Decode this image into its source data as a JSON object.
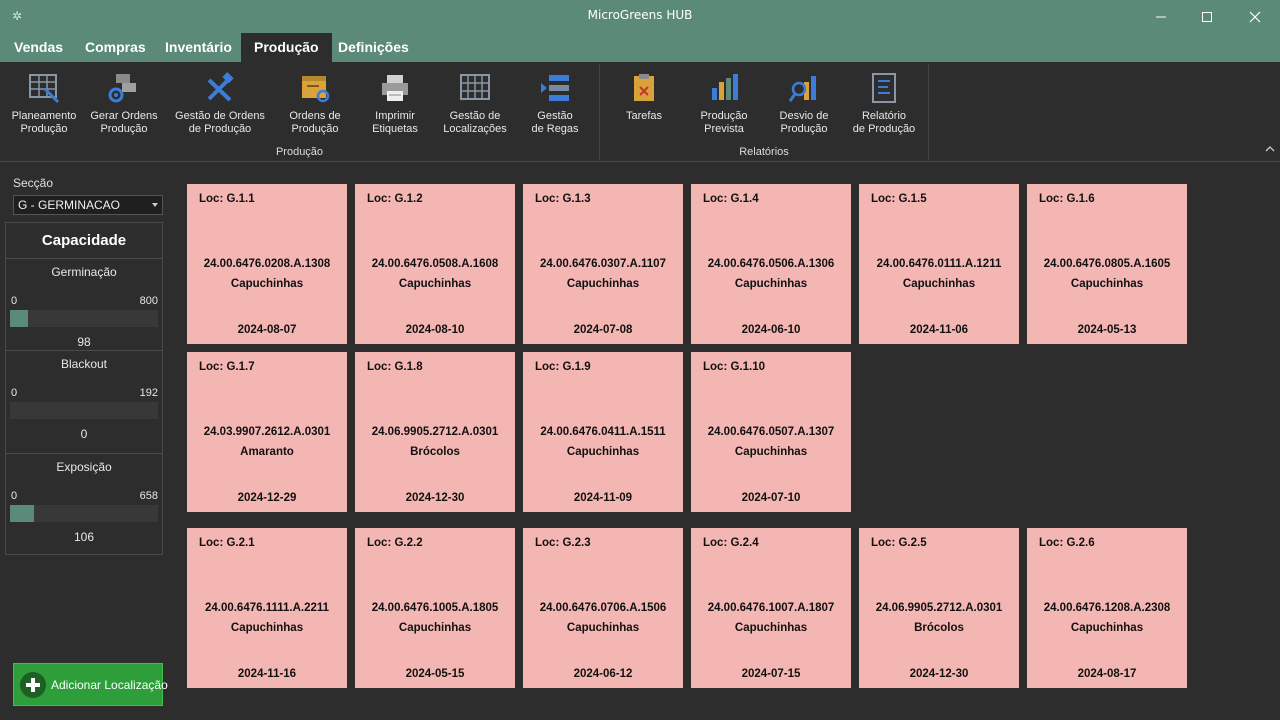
{
  "window": {
    "title": "MicroGreens HUB"
  },
  "menu_tabs": [
    {
      "label": "Vendas",
      "active": false
    },
    {
      "label": "Compras",
      "active": false
    },
    {
      "label": "Inventário",
      "active": false
    },
    {
      "label": "Produção",
      "active": true
    },
    {
      "label": "Definições",
      "active": false
    }
  ],
  "ribbon": {
    "groups": [
      {
        "label": "Produção"
      },
      {
        "label": "Relatórios"
      }
    ],
    "buttons": [
      {
        "label": "Planeamento\nProdução",
        "icon": "planning-grid-icon"
      },
      {
        "label": "Gerar Ordens\nProdução",
        "icon": "generate-orders-icon"
      },
      {
        "label": "Gestão de Ordens\nde Produção",
        "icon": "tools-icon"
      },
      {
        "label": "Ordens de\nProdução",
        "icon": "orders-box-icon"
      },
      {
        "label": "Imprimir\nEtiquetas",
        "icon": "printer-icon"
      },
      {
        "label": "Gestão de\nLocalizações",
        "icon": "locations-grid-icon"
      },
      {
        "label": "Gestão\nde Regas",
        "icon": "watering-list-icon"
      },
      {
        "label": "Tarefas",
        "icon": "clipboard-icon"
      },
      {
        "label": "Produção\nPrevista",
        "icon": "bar-chart-icon"
      },
      {
        "label": "Desvio de\nProdução",
        "icon": "chart-search-icon"
      },
      {
        "label": "Relatório\nde Produção",
        "icon": "report-icon"
      }
    ]
  },
  "section": {
    "label": "Secção",
    "value": "G - GERMINACAO"
  },
  "capacity": {
    "title": "Capacidade",
    "blocks": [
      {
        "name": "Germinação",
        "min": "0",
        "max": "800",
        "value": "98",
        "fraction": 0.1225
      },
      {
        "name": "Blackout",
        "min": "0",
        "max": "192",
        "value": "0",
        "fraction": 0
      },
      {
        "name": "Exposição",
        "min": "0",
        "max": "658",
        "value": "106",
        "fraction": 0.161
      }
    ]
  },
  "add_location_label": "Adicionar Localização",
  "cards": [
    {
      "loc": "Loc: G.1.1",
      "code": "24.00.6476.0208.A.1308",
      "crop": "Capuchinhas",
      "date": "2024-08-07"
    },
    {
      "loc": "Loc: G.1.2",
      "code": "24.00.6476.0508.A.1608",
      "crop": "Capuchinhas",
      "date": "2024-08-10"
    },
    {
      "loc": "Loc: G.1.3",
      "code": "24.00.6476.0307.A.1107",
      "crop": "Capuchinhas",
      "date": "2024-07-08"
    },
    {
      "loc": "Loc: G.1.4",
      "code": "24.00.6476.0506.A.1306",
      "crop": "Capuchinhas",
      "date": "2024-06-10"
    },
    {
      "loc": "Loc: G.1.5",
      "code": "24.00.6476.0111.A.1211",
      "crop": "Capuchinhas",
      "date": "2024-11-06"
    },
    {
      "loc": "Loc: G.1.6",
      "code": "24.00.6476.0805.A.1605",
      "crop": "Capuchinhas",
      "date": "2024-05-13"
    },
    {
      "loc": "Loc: G.1.7",
      "code": "24.03.9907.2612.A.0301",
      "crop": "Amaranto",
      "date": "2024-12-29"
    },
    {
      "loc": "Loc: G.1.8",
      "code": "24.06.9905.2712.A.0301",
      "crop": "Brócolos",
      "date": "2024-12-30"
    },
    {
      "loc": "Loc: G.1.9",
      "code": "24.00.6476.0411.A.1511",
      "crop": "Capuchinhas",
      "date": "2024-11-09"
    },
    {
      "loc": "Loc: G.1.10",
      "code": "24.00.6476.0507.A.1307",
      "crop": "Capuchinhas",
      "date": "2024-07-10"
    },
    {
      "loc": "Loc: G.2.1",
      "code": "24.00.6476.1111.A.2211",
      "crop": "Capuchinhas",
      "date": "2024-11-16"
    },
    {
      "loc": "Loc: G.2.2",
      "code": "24.00.6476.1005.A.1805",
      "crop": "Capuchinhas",
      "date": "2024-05-15"
    },
    {
      "loc": "Loc: G.2.3",
      "code": "24.00.6476.0706.A.1506",
      "crop": "Capuchinhas",
      "date": "2024-06-12"
    },
    {
      "loc": "Loc: G.2.4",
      "code": "24.00.6476.1007.A.1807",
      "crop": "Capuchinhas",
      "date": "2024-07-15"
    },
    {
      "loc": "Loc: G.2.5",
      "code": "24.06.9905.2712.A.0301",
      "crop": "Brócolos",
      "date": "2024-12-30"
    },
    {
      "loc": "Loc: G.2.6",
      "code": "24.00.6476.1208.A.2308",
      "crop": "Capuchinhas",
      "date": "2024-08-17"
    }
  ],
  "colors": {
    "accent": "#5b8a78",
    "card": "#f4b6b2",
    "add_button": "#2e9e3a"
  }
}
